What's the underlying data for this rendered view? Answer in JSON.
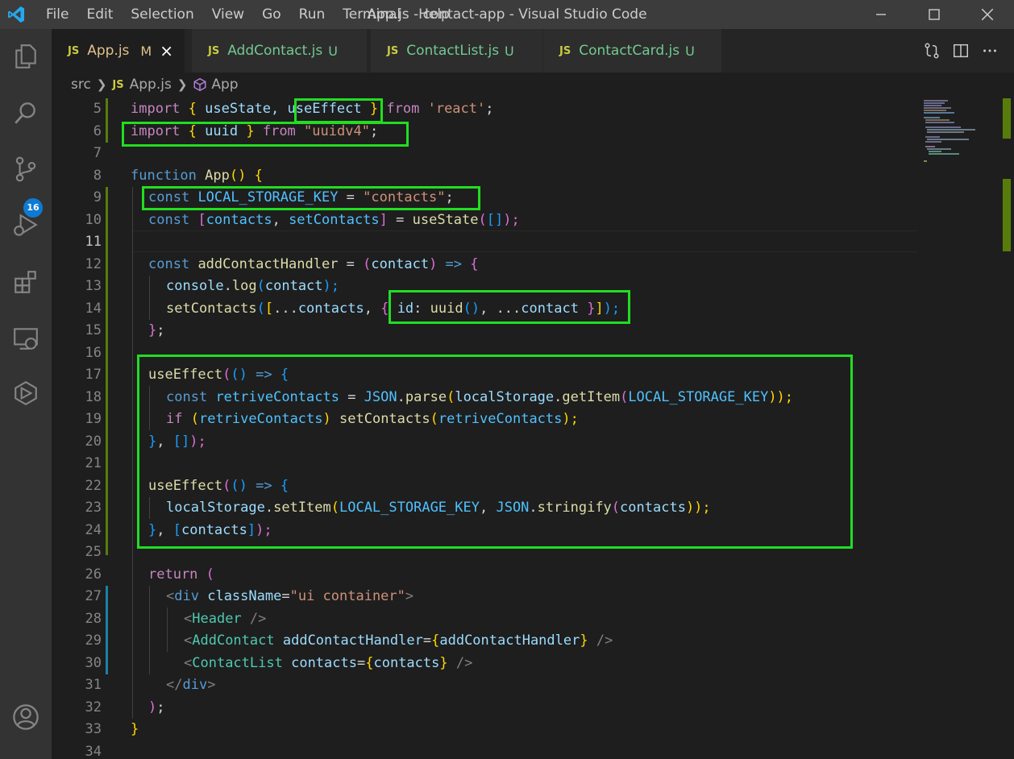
{
  "window": {
    "title": "App.js - contact-app - Visual Studio Code"
  },
  "menu": [
    "File",
    "Edit",
    "Selection",
    "View",
    "Go",
    "Run",
    "Terminal",
    "Help"
  ],
  "activity": {
    "scm_badge": "16"
  },
  "tabs": [
    {
      "icon": "JS",
      "label": "App.js",
      "status": "M"
    },
    {
      "icon": "JS",
      "label": "AddContact.js",
      "status": "U"
    },
    {
      "icon": "JS",
      "label": "ContactList.js",
      "status": "U"
    },
    {
      "icon": "JS",
      "label": "ContactCard.js",
      "status": "U"
    }
  ],
  "breadcrumb": {
    "folder": "src",
    "file_icon": "JS",
    "file": "App.js",
    "symbol": "App"
  },
  "editor": {
    "line_numbers": [
      "5",
      "6",
      "7",
      "8",
      "9",
      "10",
      "11",
      "12",
      "13",
      "14",
      "15",
      "16",
      "17",
      "18",
      "19",
      "20",
      "21",
      "22",
      "23",
      "24",
      "25",
      "26",
      "27",
      "28",
      "29",
      "30",
      "31",
      "32",
      "33",
      "34"
    ],
    "current_line": "11",
    "code": {
      "l5": [
        "import",
        " ",
        "{",
        " useState, ",
        "useEffect",
        " ",
        "}",
        " ",
        "from",
        " ",
        "'react'",
        ";"
      ],
      "l6": [
        "import",
        " ",
        "{",
        " uuid ",
        "}",
        " ",
        "from",
        " ",
        "\"uuidv4\"",
        ";"
      ],
      "l8": [
        "function",
        " ",
        "App",
        "()",
        " ",
        "{"
      ],
      "l9": [
        "const",
        " ",
        "LOCAL_STORAGE_KEY",
        " = ",
        "\"contacts\"",
        ";"
      ],
      "l10": [
        "const",
        " ",
        "[",
        "contacts",
        ", ",
        "setContacts",
        "]",
        " = ",
        "useState",
        "(",
        "[]",
        ");"
      ],
      "l12": [
        "const",
        " ",
        "addContactHandler",
        " = ",
        "(",
        "contact",
        ")",
        " => ",
        "{"
      ],
      "l13": [
        "console",
        ".",
        "log",
        "(",
        "contact",
        ");"
      ],
      "l14": [
        "setContacts",
        "(",
        "[",
        "...",
        "contacts",
        ", ",
        "{",
        " ",
        "id",
        ": ",
        "uuid",
        "()",
        ", ...",
        "contact",
        " ",
        "}",
        "]",
        ");"
      ],
      "l15": [
        "}",
        ";"
      ],
      "l17": [
        "useEffect",
        "(",
        "()",
        " => ",
        "{"
      ],
      "l18": [
        "const",
        " ",
        "retriveContacts",
        " = ",
        "JSON",
        ".",
        "parse",
        "(",
        "localStorage",
        ".",
        "getItem",
        "(",
        "LOCAL_STORAGE_KEY",
        "));"
      ],
      "l19": [
        "if",
        " ",
        "(",
        "retriveContacts",
        ")",
        " ",
        "setContacts",
        "(",
        "retriveContacts",
        ");"
      ],
      "l20": [
        "}",
        ", ",
        "[]",
        ");"
      ],
      "l22": [
        "useEffect",
        "(",
        "()",
        " => ",
        "{"
      ],
      "l23": [
        "localStorage",
        ".",
        "setItem",
        "(",
        "LOCAL_STORAGE_KEY",
        ", ",
        "JSON",
        ".",
        "stringify",
        "(",
        "contacts",
        "));"
      ],
      "l24": [
        "}",
        ", ",
        "[",
        "contacts",
        "]",
        ");"
      ],
      "l26": [
        "return",
        " ",
        "("
      ],
      "l27": [
        "<",
        "div",
        " ",
        "className",
        "=",
        "\"ui container\"",
        ">"
      ],
      "l28": [
        "<",
        "Header",
        " ",
        "/>"
      ],
      "l29": [
        "<",
        "AddContact",
        " ",
        "addContactHandler",
        "=",
        "{",
        "addContactHandler",
        "}",
        " ",
        "/>"
      ],
      "l30": [
        "<",
        "ContactList",
        " ",
        "contacts",
        "=",
        "{",
        "contacts",
        "}",
        " ",
        "/>"
      ],
      "l31": [
        "</",
        "div",
        ">"
      ],
      "l32": [
        ")",
        ";"
      ],
      "l33": [
        "}"
      ]
    }
  },
  "colors": {
    "highlight_box": "#22dd22",
    "modified_gutter": "#587c0c",
    "added_gutter": "#1b81a8",
    "badge": "#0e7ad3"
  }
}
